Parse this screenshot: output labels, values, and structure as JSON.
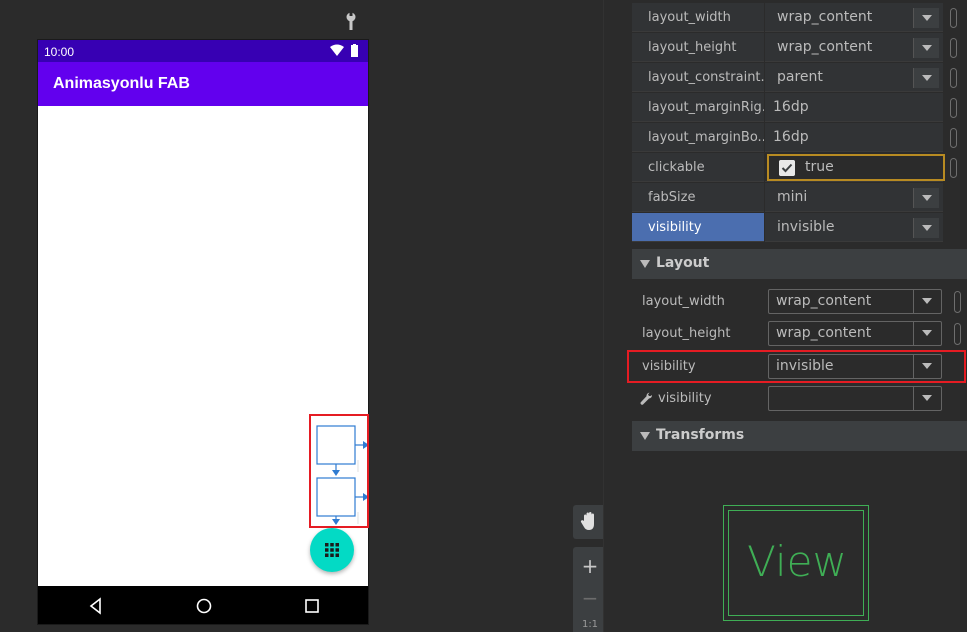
{
  "device": {
    "status_time": "10:00",
    "app_title": "Animasyonlu FAB"
  },
  "zoom": {
    "zoom_in": "+",
    "zoom_out": "−",
    "reset": "1:1"
  },
  "attributes": [
    {
      "name": "layout_width",
      "value": "wrap_content",
      "dropdown": true
    },
    {
      "name": "layout_height",
      "value": "wrap_content",
      "dropdown": true
    },
    {
      "name": "layout_constraint...",
      "value": "parent",
      "dropdown": true
    },
    {
      "name": "layout_marginRig...",
      "value": "16dp",
      "dropdown": false
    },
    {
      "name": "layout_marginBo...",
      "value": "16dp",
      "dropdown": false
    },
    {
      "name": "clickable",
      "value": "true",
      "checkbox": true
    },
    {
      "name": "fabSize",
      "value": "mini",
      "dropdown": true
    },
    {
      "name": "visibility",
      "value": "invisible",
      "dropdown": true,
      "selected": true
    }
  ],
  "layout_section": {
    "title": "Layout",
    "rows": [
      {
        "name": "layout_width",
        "value": "wrap_content"
      },
      {
        "name": "layout_height",
        "value": "wrap_content"
      },
      {
        "name": "visibility",
        "value": "invisible"
      },
      {
        "name": "visibility",
        "value": "",
        "tool": true
      }
    ]
  },
  "transforms_section": {
    "title": "Transforms"
  },
  "preview": {
    "label": "View"
  },
  "colors": {
    "status_bar": "#3700b3",
    "app_bar": "#6200ee",
    "fab": "#03dac5",
    "selection": "#e51c23",
    "preview": "#3fae55",
    "focus": "#b88b22",
    "row_highlight": "#4b6eaf"
  }
}
